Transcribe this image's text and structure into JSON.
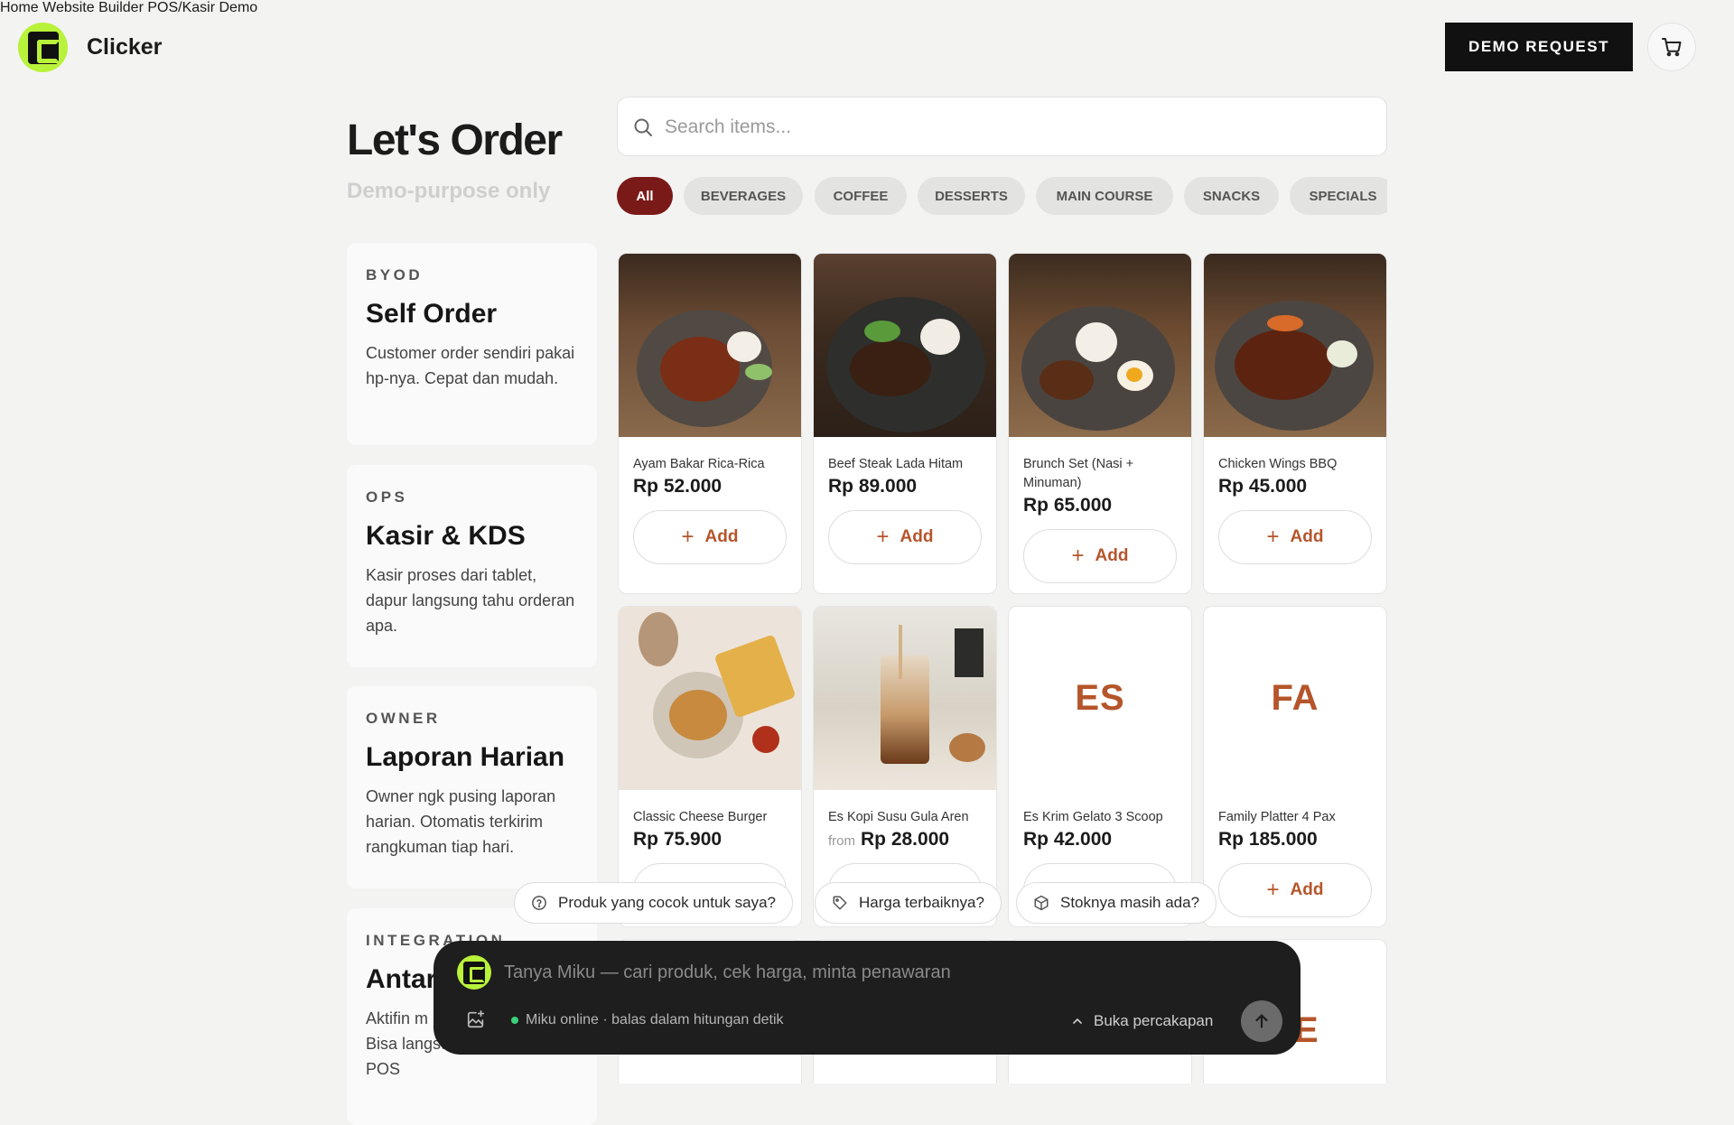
{
  "header": {
    "brand": "Clicker",
    "nav": [
      "Home",
      "Website Builder",
      "POS/Kasir Demo"
    ],
    "demo_button": "DEMO REQUEST"
  },
  "page": {
    "title": "Let's Order",
    "subtitle": "Demo-purpose only"
  },
  "search": {
    "placeholder": "Search items..."
  },
  "categories": [
    "All",
    "BEVERAGES",
    "COFFEE",
    "DESSERTS",
    "MAIN COURSE",
    "SNACKS",
    "SPECIALS"
  ],
  "active_category": "All",
  "features": [
    {
      "tag": "BYOD",
      "title": "Self Order",
      "desc": "Customer order sendiri pakai hp-nya. Cepat dan mudah."
    },
    {
      "tag": "OPS",
      "title": "Kasir & KDS",
      "desc": "Kasir proses dari tablet, dapur langsung tahu orderan apa."
    },
    {
      "tag": "OWNER",
      "title": "Laporan Harian",
      "desc": "Owner ngk pusing laporan harian. Otomatis terkirim rangkuman tiap hari."
    },
    {
      "tag": "INTEGRATION",
      "title": "Antar",
      "desc": "Aktifin m inventory, loyalty? Bisa langsung connect ke POS"
    }
  ],
  "products": [
    {
      "name": "Ayam Bakar Rica-Rica",
      "price": "Rp 52.000",
      "from": "",
      "image": "grilled-chicken-plate",
      "initials": ""
    },
    {
      "name": "Beef Steak Lada Hitam",
      "price": "Rp 89.000",
      "from": "",
      "image": "beef-steak-plate",
      "initials": ""
    },
    {
      "name": "Brunch Set (Nasi + Minuman)",
      "price": "Rp 65.000",
      "from": "",
      "image": "brunch-set-plate",
      "initials": ""
    },
    {
      "name": "Chicken Wings BBQ",
      "price": "Rp 45.000",
      "from": "",
      "image": "chicken-wings-plate",
      "initials": ""
    },
    {
      "name": "Classic Cheese Burger",
      "price": "Rp 75.900",
      "from": "",
      "image": "burger-fries",
      "initials": ""
    },
    {
      "name": "Es Kopi Susu Gula Aren",
      "price": "Rp 28.000",
      "from": "from",
      "image": "iced-coffee",
      "initials": ""
    },
    {
      "name": "Es Krim Gelato 3 Scoop",
      "price": "Rp 42.000",
      "from": "",
      "image": "",
      "initials": "ES"
    },
    {
      "name": "Family Platter 4 Pax",
      "price": "Rp 185.000",
      "from": "",
      "image": "",
      "initials": "FA"
    }
  ],
  "row3_partial_initials": "E",
  "add_label": "Add",
  "suggestions": [
    "Produk yang cocok untuk saya?",
    "Harga terbaiknya?",
    "Stoknya masih ada?"
  ],
  "chat": {
    "placeholder": "Tanya Miku — cari produk, cek harga, minta penawaran",
    "status": "Miku online · balas dalam hitungan detik",
    "open_label": "Buka percakapan"
  },
  "colors": {
    "accent": "#b5552b",
    "active_chip": "#7a1a18",
    "brand_green": "#b9f23a",
    "chat_bg": "#1e1e1e"
  }
}
